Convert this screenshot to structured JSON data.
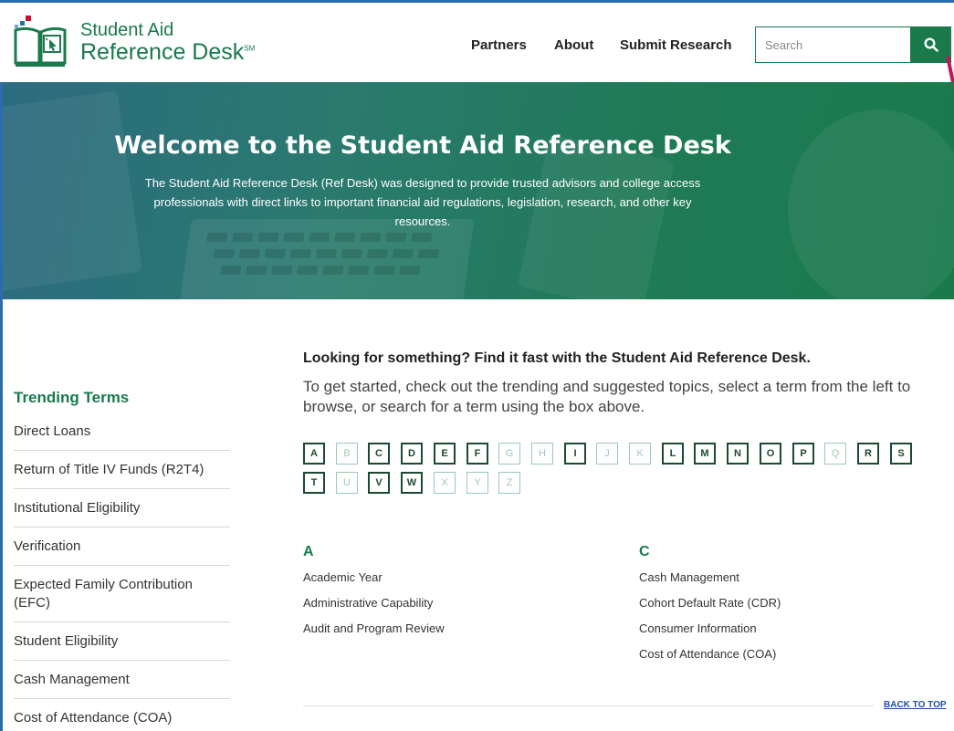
{
  "header": {
    "logo_line1": "Student Aid",
    "logo_line2": "Reference Desk",
    "logo_tm": "SM",
    "nav": [
      "Partners",
      "About",
      "Submit Research"
    ],
    "search_placeholder": "Search",
    "search_icon": "search-icon"
  },
  "hero": {
    "title": "Welcome to the Student Aid Reference Desk",
    "description": "The Student Aid Reference Desk (Ref Desk) was designed to provide trusted advisors and college access professionals with direct links to important financial aid regulations, legislation, research, and other key resources."
  },
  "sidebar": {
    "title": "Trending Terms",
    "items": [
      "Direct Loans",
      "Return of Title IV Funds (R2T4)",
      "Institutional Eligibility",
      "Verification",
      "Expected Family Contribution (EFC)",
      "Student Eligibility",
      "Cash Management",
      "Cost of Attendance (COA)"
    ]
  },
  "main": {
    "heading": "Looking for something? Find it fast with the Student Aid Reference Desk.",
    "intro": "To get started, check out the trending and suggested topics, select a term from the left to browse, or search for a term using the box above.",
    "alphabet": [
      {
        "letter": "A",
        "enabled": true
      },
      {
        "letter": "B",
        "enabled": false
      },
      {
        "letter": "C",
        "enabled": true
      },
      {
        "letter": "D",
        "enabled": true
      },
      {
        "letter": "E",
        "enabled": true
      },
      {
        "letter": "F",
        "enabled": true
      },
      {
        "letter": "G",
        "enabled": false
      },
      {
        "letter": "H",
        "enabled": false
      },
      {
        "letter": "I",
        "enabled": true
      },
      {
        "letter": "J",
        "enabled": false
      },
      {
        "letter": "K",
        "enabled": false
      },
      {
        "letter": "L",
        "enabled": true
      },
      {
        "letter": "M",
        "enabled": true
      },
      {
        "letter": "N",
        "enabled": true
      },
      {
        "letter": "O",
        "enabled": true
      },
      {
        "letter": "P",
        "enabled": true
      },
      {
        "letter": "Q",
        "enabled": false
      },
      {
        "letter": "R",
        "enabled": true
      },
      {
        "letter": "S",
        "enabled": true
      },
      {
        "letter": "T",
        "enabled": true
      },
      {
        "letter": "U",
        "enabled": false
      },
      {
        "letter": "V",
        "enabled": true
      },
      {
        "letter": "W",
        "enabled": true
      },
      {
        "letter": "X",
        "enabled": false
      },
      {
        "letter": "Y",
        "enabled": false
      },
      {
        "letter": "Z",
        "enabled": false
      }
    ],
    "groups": [
      {
        "letter": "A",
        "terms": [
          "Academic Year",
          "Administrative Capability",
          "Audit and Program Review"
        ]
      },
      {
        "letter": "C",
        "terms": [
          "Cash Management",
          "Cohort Default Rate (CDR)",
          "Consumer Information",
          "Cost of Attendance (COA)"
        ]
      }
    ],
    "back_to_top": "BACK TO TOP"
  },
  "colors": {
    "brand_green": "#1a7a4c",
    "link_blue": "#1f4fa8",
    "disabled_letter": "#9ccab0"
  }
}
